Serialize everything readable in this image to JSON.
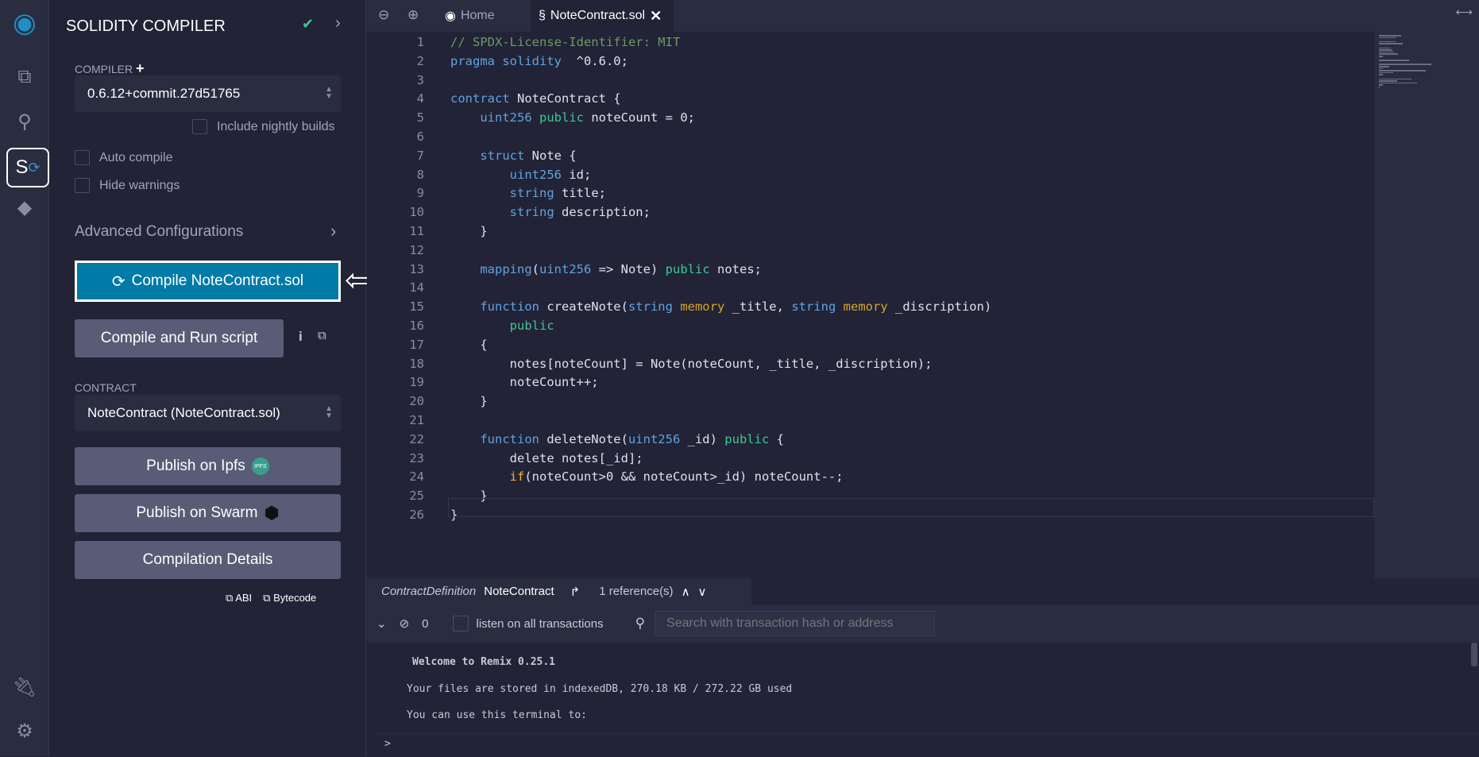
{
  "panel": {
    "title": "SOLIDITY COMPILER",
    "compiler_label": "COMPILER",
    "compiler_version": "0.6.12+commit.27d51765",
    "nightly": "Include nightly builds",
    "auto_compile": "Auto compile",
    "hide_warnings": "Hide warnings",
    "advanced": "Advanced Configurations",
    "compile_btn": "Compile NoteContract.sol",
    "run_script_btn": "Compile and Run script",
    "contract_label": "CONTRACT",
    "contract_value": "NoteContract (NoteContract.sol)",
    "ipfs_btn": "Publish on Ipfs",
    "ipfs_badge": "IPFS",
    "swarm_btn": "Publish on Swarm",
    "details_btn": "Compilation Details",
    "abi": "ABI",
    "bytecode": "Bytecode"
  },
  "tabs": [
    {
      "label": "Home"
    },
    {
      "label": "NoteContract.sol"
    }
  ],
  "code": [
    [
      [
        "cm",
        "// SPDX-License-Identifier: MIT"
      ]
    ],
    [
      [
        "kw",
        "pragma solidity"
      ],
      [
        "",
        "  ^0.6.0;"
      ]
    ],
    [],
    [
      [
        "kw",
        "contract"
      ],
      [
        "",
        " NoteContract {"
      ]
    ],
    [
      [
        "",
        "    "
      ],
      [
        "kw",
        "uint256"
      ],
      [
        "",
        " "
      ],
      [
        "pub",
        "public"
      ],
      [
        "",
        " noteCount = 0;"
      ]
    ],
    [],
    [
      [
        "",
        "    "
      ],
      [
        "kw",
        "struct"
      ],
      [
        "",
        " Note {"
      ]
    ],
    [
      [
        "",
        "        "
      ],
      [
        "kw",
        "uint256"
      ],
      [
        "",
        " id;"
      ]
    ],
    [
      [
        "",
        "        "
      ],
      [
        "kw",
        "string"
      ],
      [
        "",
        " title;"
      ]
    ],
    [
      [
        "",
        "        "
      ],
      [
        "kw",
        "string"
      ],
      [
        "",
        " description;"
      ]
    ],
    [
      [
        "",
        "    }"
      ]
    ],
    [],
    [
      [
        "",
        "    "
      ],
      [
        "kw",
        "mapping"
      ],
      [
        "",
        "("
      ],
      [
        "kw",
        "uint256"
      ],
      [
        "",
        " => Note) "
      ],
      [
        "pub",
        "public"
      ],
      [
        "",
        " notes;"
      ]
    ],
    [],
    [
      [
        "",
        "    "
      ],
      [
        "kw",
        "function"
      ],
      [
        "",
        " createNote("
      ],
      [
        "kw",
        "string"
      ],
      [
        "",
        " "
      ],
      [
        "mem",
        "memory"
      ],
      [
        "",
        " _title, "
      ],
      [
        "kw",
        "string"
      ],
      [
        "",
        " "
      ],
      [
        "mem",
        "memory"
      ],
      [
        "",
        " _discription)"
      ]
    ],
    [
      [
        "",
        "        "
      ],
      [
        "pub",
        "public"
      ]
    ],
    [
      [
        "",
        "    {"
      ]
    ],
    [
      [
        "",
        "        notes[noteCount] = Note(noteCount, _title, _discription);"
      ]
    ],
    [
      [
        "",
        "        noteCount++;"
      ]
    ],
    [
      [
        "",
        "    }"
      ]
    ],
    [],
    [
      [
        "",
        "    "
      ],
      [
        "kw",
        "function"
      ],
      [
        "",
        " deleteNote("
      ],
      [
        "kw",
        "uint256"
      ],
      [
        "",
        " _id) "
      ],
      [
        "pub",
        "public"
      ],
      [
        "",
        " {"
      ]
    ],
    [
      [
        "",
        "        delete notes[_id];"
      ]
    ],
    [
      [
        "",
        "        "
      ],
      [
        "ctl",
        "if"
      ],
      [
        "",
        "(noteCount>0 && noteCount>_id) noteCount--;"
      ]
    ],
    [
      [
        "",
        "    }"
      ]
    ],
    [
      [
        "",
        "}"
      ]
    ]
  ],
  "refbar": {
    "kind": "ContractDefinition",
    "name": "NoteContract",
    "refs": "1 reference(s)"
  },
  "terminal": {
    "count": "0",
    "listen": "listen on all transactions",
    "search_placeholder": "Search with transaction hash or address",
    "welcome": "Welcome to Remix 0.25.1",
    "storage": "Your files are stored in indexedDB, 270.18 KB / 272.22 GB used",
    "usage": "You can use this terminal to:",
    "prompt": ">"
  },
  "colors": {
    "accent": "#007aa6",
    "success": "#3fc694"
  }
}
